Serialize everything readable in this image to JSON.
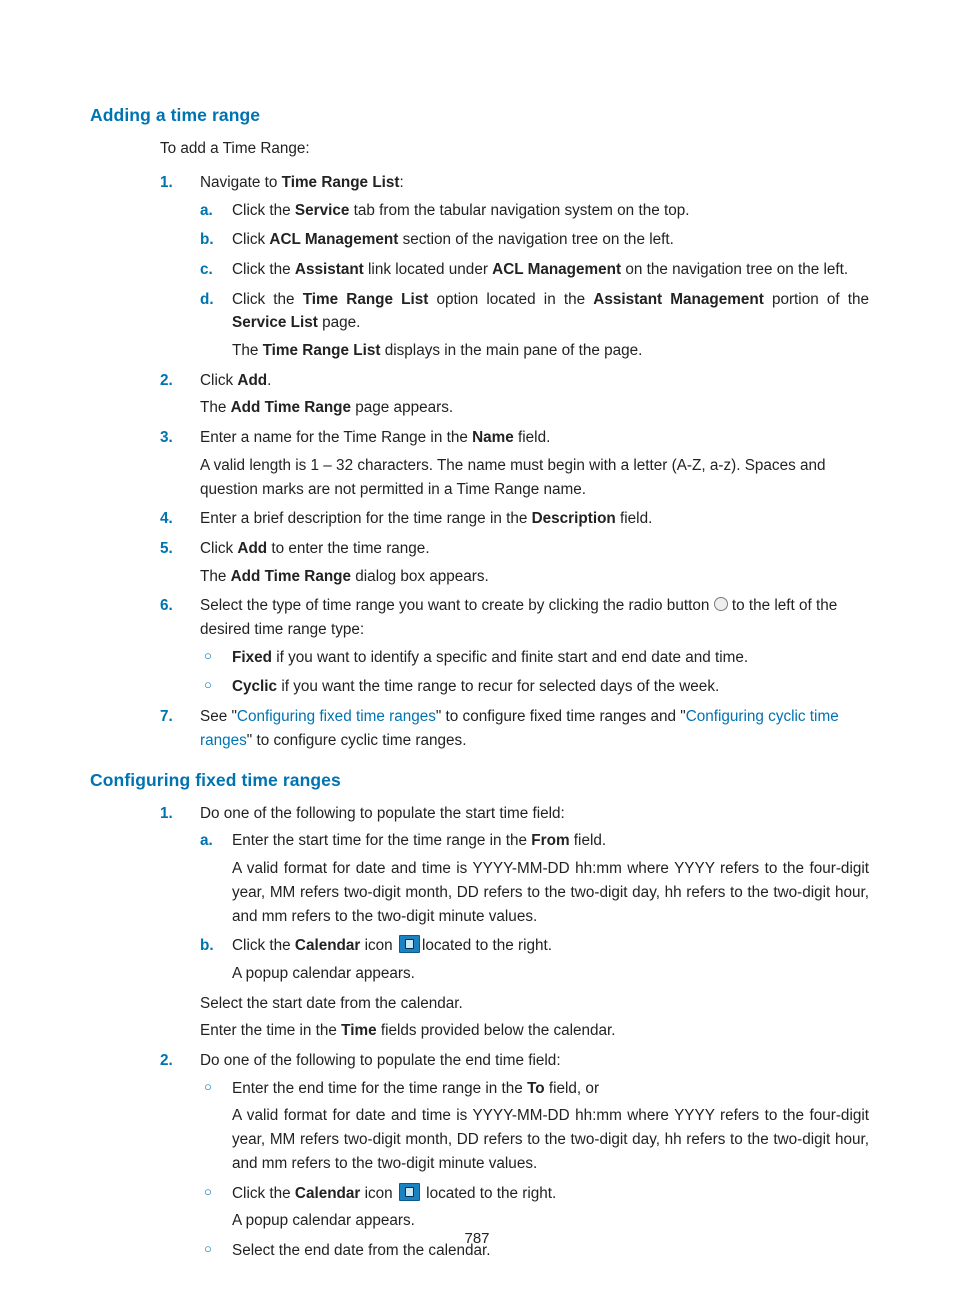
{
  "pageNumber": "787",
  "section1": {
    "heading": "Adding a time range",
    "intro": "To add a Time Range:",
    "step1_a": "Navigate to ",
    "step1_b": "Time Range List",
    "step1_c": ":",
    "s1a_a": "Click the ",
    "s1a_b": "Service",
    "s1a_c": " tab from the tabular navigation system on the top.",
    "s1b_a": "Click ",
    "s1b_b": "ACL Management",
    "s1b_c": " section of the navigation tree on the left.",
    "s1c_a": "Click the ",
    "s1c_b": "Assistant",
    "s1c_c": " link located under ",
    "s1c_d": "ACL Management",
    "s1c_e": " on the navigation tree on the left.",
    "s1d_a": "Click the ",
    "s1d_b": "Time Range List",
    "s1d_c": " option located in the ",
    "s1d_d": "Assistant Management",
    "s1d_e": " portion of the ",
    "s1d_f": "Service List",
    "s1d_g": " page.",
    "s1d_sub_a": "The ",
    "s1d_sub_b": "Time Range List",
    "s1d_sub_c": " displays in the main pane of the page.",
    "step2_a": "Click ",
    "step2_b": "Add",
    "step2_c": ".",
    "step2_sub_a": "The ",
    "step2_sub_b": "Add Time Range",
    "step2_sub_c": " page appears.",
    "step3_a": "Enter a name for the Time Range in the ",
    "step3_b": "Name",
    "step3_c": " field.",
    "step3_sub": "A valid length is 1 – 32 characters. The name must begin with a letter (A-Z, a-z). Spaces and question marks are not permitted in a Time Range name.",
    "step4_a": "Enter a brief description for the time range in the ",
    "step4_b": "Description",
    "step4_c": " field.",
    "step5_a": "Click ",
    "step5_b": "Add",
    "step5_c": " to enter the time range.",
    "step5_sub_a": "The ",
    "step5_sub_b": "Add Time Range",
    "step5_sub_c": " dialog box appears.",
    "step6_a": "Select the type of time range you want to create by clicking the radio button ",
    "step6_b": " to the left of the desired time range type:",
    "s6_fixed_a": "Fixed",
    "s6_fixed_b": " if you want to identify a specific and finite start and end date and time.",
    "s6_cyclic_a": "Cyclic",
    "s6_cyclic_b": " if you want the time range to recur for selected days of the week.",
    "step7_a": "See \"",
    "step7_link1": "Configuring fixed time ranges",
    "step7_b": "\" to configure fixed time ranges and \"",
    "step7_link2": "Configuring cyclic time ranges",
    "step7_c": "\" to configure cyclic time ranges."
  },
  "section2": {
    "heading": "Configuring fixed time ranges",
    "step1": "Do one of the following to populate the start time field:",
    "s1a_a": "Enter the start time for the time range in the ",
    "s1a_b": "From",
    "s1a_c": " field.",
    "s1a_sub": "A valid format for date and time is YYYY-MM-DD hh:mm where YYYY refers to the four-digit year, MM refers two-digit month, DD refers to the two-digit day, hh refers to the two-digit hour, and mm refers to the two-digit minute values.",
    "s1b_a": "Click the ",
    "s1b_b": "Calendar",
    "s1b_c": " icon ",
    "s1b_d": "located to the right.",
    "s1b_sub": "A popup calendar appears.",
    "s1_after1": "Select the start date from the calendar.",
    "s1_after2_a": "Enter the time in the ",
    "s1_after2_b": "Time",
    "s1_after2_c": " fields provided below the calendar.",
    "step2": "Do one of the following to populate the end time field:",
    "s2a_a": "Enter the end time for the time range in the ",
    "s2a_b": "To",
    "s2a_c": " field, or",
    "s2a_sub": "A valid format for date and time is YYYY-MM-DD hh:mm where YYYY refers to the four-digit year, MM refers two-digit month, DD refers to the two-digit day, hh refers to the two-digit hour, and mm refers to the two-digit minute values.",
    "s2b_a": "Click the ",
    "s2b_b": "Calendar",
    "s2b_c": " icon ",
    "s2b_d": " located to the right.",
    "s2b_sub": "A popup calendar appears.",
    "s2c": "Select the end date from the calendar."
  }
}
